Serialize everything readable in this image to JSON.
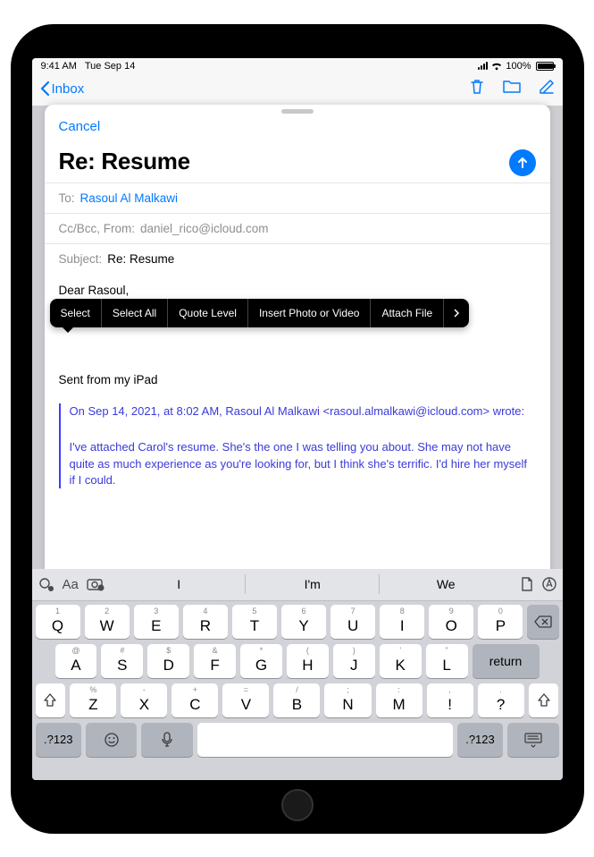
{
  "status": {
    "time": "9:41 AM",
    "date": "Tue Sep 14",
    "battery_pct": "100%"
  },
  "nav": {
    "back_label": "Inbox"
  },
  "compose": {
    "cancel": "Cancel",
    "title": "Re: Resume",
    "to_label": "To:",
    "to_value": "Rasoul Al Malkawi",
    "ccbcc_label": "Cc/Bcc, From:",
    "ccbcc_value": "daniel_rico@icloud.com",
    "subject_label": "Subject:",
    "subject_value": "Re: Resume",
    "body_greeting": "Dear Rasoul,",
    "signature": "Sent from my iPad",
    "quote_header": "On Sep 14, 2021, at 8:02 AM, Rasoul Al Malkawi <rasoul.almalkawi@icloud.com> wrote:",
    "quote_body": "I've attached Carol's resume. She's the one I was telling you about. She may not have quite as much experience as you're looking for, but I think she's terrific. I'd hire her myself if I could."
  },
  "edit_menu": {
    "select": "Select",
    "select_all": "Select All",
    "quote_level": "Quote Level",
    "insert_photo": "Insert Photo or Video",
    "attach_file": "Attach File"
  },
  "keyboard": {
    "suggestions": [
      "I",
      "I'm",
      "We"
    ],
    "row1": [
      {
        "main": "Q",
        "sub": "1"
      },
      {
        "main": "W",
        "sub": "2"
      },
      {
        "main": "E",
        "sub": "3"
      },
      {
        "main": "R",
        "sub": "4"
      },
      {
        "main": "T",
        "sub": "5"
      },
      {
        "main": "Y",
        "sub": "6"
      },
      {
        "main": "U",
        "sub": "7"
      },
      {
        "main": "I",
        "sub": "8"
      },
      {
        "main": "O",
        "sub": "9"
      },
      {
        "main": "P",
        "sub": "0"
      }
    ],
    "row2": [
      {
        "main": "A",
        "sub": "@"
      },
      {
        "main": "S",
        "sub": "#"
      },
      {
        "main": "D",
        "sub": "$"
      },
      {
        "main": "F",
        "sub": "&"
      },
      {
        "main": "G",
        "sub": "*"
      },
      {
        "main": "H",
        "sub": "("
      },
      {
        "main": "J",
        "sub": ")"
      },
      {
        "main": "K",
        "sub": "'"
      },
      {
        "main": "L",
        "sub": "\""
      }
    ],
    "row3": [
      {
        "main": "Z",
        "sub": "%"
      },
      {
        "main": "X",
        "sub": "-"
      },
      {
        "main": "C",
        "sub": "+"
      },
      {
        "main": "V",
        "sub": "="
      },
      {
        "main": "B",
        "sub": "/"
      },
      {
        "main": "N",
        "sub": ";"
      },
      {
        "main": "M",
        "sub": ":"
      },
      {
        "main": "!",
        "sub": ","
      },
      {
        "main": "?",
        "sub": "."
      }
    ],
    "return": "return",
    "numkey": ".?123"
  }
}
